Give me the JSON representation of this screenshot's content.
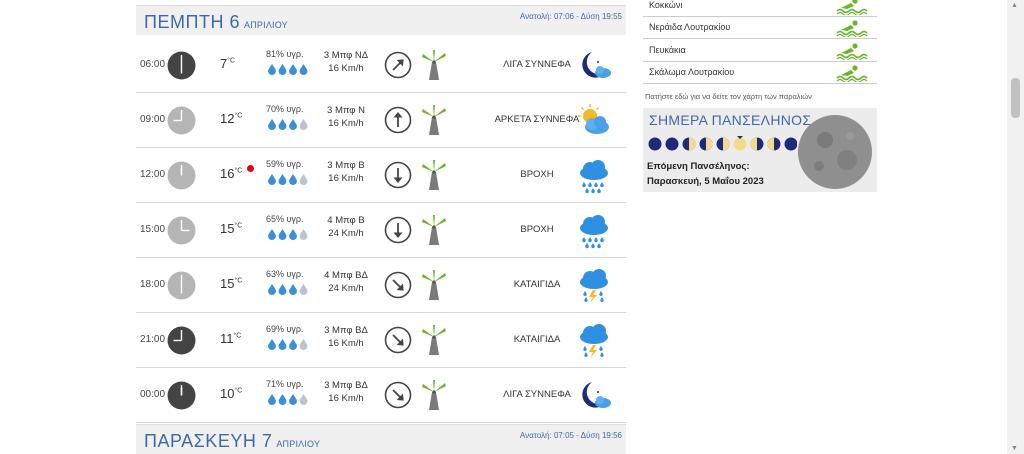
{
  "days": [
    {
      "name": "ΠΕΜΠΤΗ 6",
      "month": "ΑΠΡΙΛΙΟΥ",
      "sun": "Ανατολή: 07:06 - Δύση 19:55"
    },
    {
      "name": "ΠΑΡΑΣΚΕΥΗ 7",
      "month": "ΑΠΡΙΛΙΟΥ",
      "sun": "Ανατολή: 07:05 - Δύση 19:56"
    }
  ],
  "rows": [
    {
      "time": "06:00",
      "temp": "7",
      "unit": "°C",
      "humidity": "81% υγρ.",
      "drops_filled": 4,
      "wind_bf": "3 Μπφ ΝΔ",
      "wind_kmh": "16 Km/h",
      "wind_dir": "ΝΔ",
      "condition": "ΛΙΓΑ ΣΥΝΝΕΦΑ",
      "icon": "night-partly-cloudy-icon",
      "clock_dark": true,
      "rain_marker": false
    },
    {
      "time": "09:00",
      "temp": "12",
      "unit": "°C",
      "humidity": "70% υγρ.",
      "drops_filled": 3,
      "wind_bf": "3 Μπφ Ν",
      "wind_kmh": "16 Km/h",
      "wind_dir": "Ν",
      "condition": "ΑΡΚΕΤΑ ΣΥΝΝΕΦΑ",
      "icon": "sun-cloud-icon",
      "clock_dark": false,
      "rain_marker": false
    },
    {
      "time": "12:00",
      "temp": "16",
      "unit": "°C",
      "humidity": "59% υγρ.",
      "drops_filled": 3,
      "wind_bf": "3 Μπφ Β",
      "wind_kmh": "16 Km/h",
      "wind_dir": "Β",
      "condition": "ΒΡΟΧΗ",
      "icon": "rain-icon",
      "clock_dark": false,
      "rain_marker": true
    },
    {
      "time": "15:00",
      "temp": "15",
      "unit": "°C",
      "humidity": "65% υγρ.",
      "drops_filled": 3,
      "wind_bf": "4 Μπφ Β",
      "wind_kmh": "24 Km/h",
      "wind_dir": "Β",
      "condition": "ΒΡΟΧΗ",
      "icon": "rain-icon",
      "clock_dark": false,
      "rain_marker": false
    },
    {
      "time": "18:00",
      "temp": "15",
      "unit": "°C",
      "humidity": "63% υγρ.",
      "drops_filled": 3,
      "wind_bf": "4 Μπφ ΒΔ",
      "wind_kmh": "24 Km/h",
      "wind_dir": "ΒΔ",
      "condition": "ΚΑΤΑΙΓΙΔΑ",
      "icon": "thunderstorm-icon",
      "clock_dark": false,
      "rain_marker": false
    },
    {
      "time": "21:00",
      "temp": "11",
      "unit": "°C",
      "humidity": "69% υγρ.",
      "drops_filled": 3,
      "wind_bf": "3 Μπφ ΒΔ",
      "wind_kmh": "16 Km/h",
      "wind_dir": "ΒΔ",
      "condition": "ΚΑΤΑΙΓΙΔΑ",
      "icon": "thunderstorm-icon",
      "clock_dark": true,
      "rain_marker": false
    },
    {
      "time": "00:00",
      "temp": "10",
      "unit": "°C",
      "humidity": "71% υγρ.",
      "drops_filled": 3,
      "wind_bf": "3 Μπφ ΒΔ",
      "wind_kmh": "16 Km/h",
      "wind_dir": "ΒΔ",
      "condition": "ΛΙΓΑ ΣΥΝΝΕΦΑ",
      "icon": "night-partly-cloudy-icon",
      "clock_dark": true,
      "rain_marker": false
    }
  ],
  "beaches": [
    "Κοκκώνι",
    "Νεράιδα Λουτρακίου",
    "Πευκάκια",
    "Σκάλωμα Λουτρακίου"
  ],
  "beach_note": "Πατήστε εδώ για να δείτε τον χάρτη των παραλιών",
  "moon": {
    "title": "ΣΗΜΕΡΑ ΠΑΝΣΕΛΗΝΟΣ",
    "next_label": "Επόμενη Πανσέληνος:",
    "next_date": "Παρασκευή, 5 Μαΐου 2023"
  },
  "colors": {
    "accent": "#3d6aa6",
    "drop": "#3b8fd9",
    "swim": "#6ab52e",
    "icon_navy": "#1f2a78",
    "rain_blue": "#2f8fe0"
  }
}
